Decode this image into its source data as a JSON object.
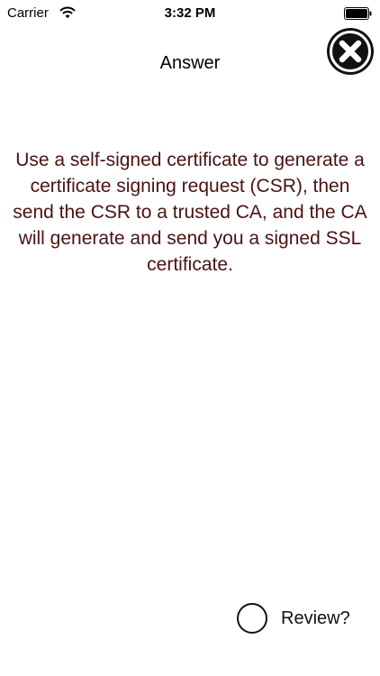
{
  "status_bar": {
    "carrier": "Carrier",
    "time": "3:32 PM",
    "wifi_icon": "wifi-icon",
    "battery_icon": "battery-icon"
  },
  "header": {
    "title": "Answer",
    "close_icon": "close-icon"
  },
  "answer": {
    "text": "Use a self-signed certificate to generate a certificate signing request (CSR), then send the CSR to a trusted CA, and the CA will generate and send you a signed SSL certificate."
  },
  "review": {
    "label": "Review?",
    "checked": false
  },
  "colors": {
    "answer_text": "#4a1212",
    "close_button": "#111111",
    "background": "#ffffff"
  }
}
